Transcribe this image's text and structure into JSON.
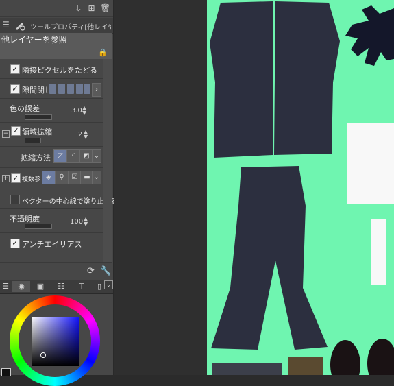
{
  "tool_property": {
    "panel_title": "ツールプロパティ[他レイヤーを参",
    "tool_name": "他レイヤーを参照",
    "rows": {
      "adjacent_pixel": "隣接ピクセルをたどる",
      "close_gap": "隙間閉じ",
      "color_margin": "色の誤差",
      "color_margin_value": "3.0",
      "area_scaling": "領域拡縮",
      "area_scaling_value": "2",
      "scaling_method": "拡縮方法",
      "multiple_reference": "複数参",
      "vector_center": "ベクターの中心線で塗り止まる",
      "opacity": "不透明度",
      "opacity_value": "100",
      "antialiasing": "アンチエイリアス"
    }
  },
  "colors": {
    "canvas_bg": "#6ff5b0",
    "garment_dark": "#2c2f3f",
    "accent_blue": "#6e7a94"
  }
}
